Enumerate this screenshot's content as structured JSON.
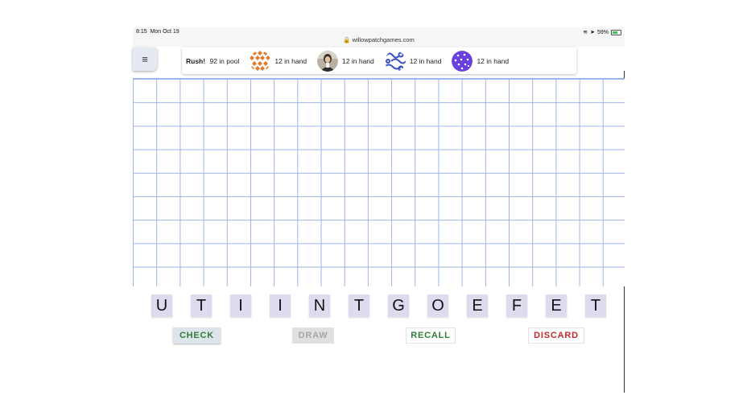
{
  "status_bar": {
    "time": "8:15",
    "date": "Mon Oct 19",
    "url": "willowpatchgames.com",
    "battery": "59%"
  },
  "menu": {
    "icon": "hamburger-icon",
    "glyph": "≡"
  },
  "players_bar": {
    "rush_label": "Rush!",
    "pool_text": "92 in pool",
    "players": [
      {
        "avatar": "orange-diamond-pattern-avatar",
        "hand_text": "12 in hand"
      },
      {
        "avatar": "photo-avatar",
        "hand_text": "12 in hand"
      },
      {
        "avatar": "blue-swirl-pattern-avatar",
        "hand_text": "12 in hand"
      },
      {
        "avatar": "purple-dots-pattern-avatar",
        "hand_text": "12 in hand"
      }
    ]
  },
  "rack": {
    "tiles": [
      "U",
      "T",
      "I",
      "I",
      "N",
      "T",
      "G",
      "O",
      "E",
      "F",
      "E",
      "T"
    ]
  },
  "actions": {
    "check": "CHECK",
    "draw": "DRAW",
    "recall": "RECALL",
    "discard": "DISCARD"
  },
  "colors": {
    "grid_line": "#9cb5ea",
    "tile_bg": "#dcdcee",
    "check_text": "#2e7d32",
    "recall_text": "#2e7d32",
    "discard_text": "#c62828",
    "draw_text_disabled": "#a5a5a5"
  }
}
